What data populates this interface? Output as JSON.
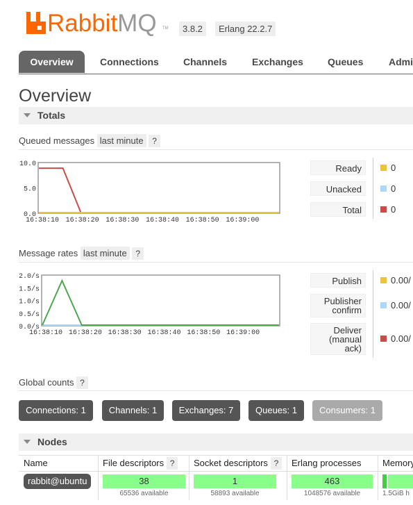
{
  "header": {
    "logo_rabbit": "Rabbit",
    "logo_mq": "MQ",
    "logo_tm": "TM",
    "version": "3.8.2",
    "erlang": "Erlang 22.2.7"
  },
  "tabs": [
    {
      "label": "Overview",
      "active": true
    },
    {
      "label": "Connections"
    },
    {
      "label": "Channels"
    },
    {
      "label": "Exchanges"
    },
    {
      "label": "Queues"
    },
    {
      "label": "Admi"
    }
  ],
  "page_title": "Overview",
  "totals": {
    "title": "Totals",
    "queued": {
      "label": "Queued messages",
      "range": "last minute",
      "help": "?",
      "legend": [
        {
          "label": "Ready",
          "value": "0",
          "color": "#edc240"
        },
        {
          "label": "Unacked",
          "value": "0",
          "color": "#afd8f8"
        },
        {
          "label": "Total",
          "value": "0",
          "color": "#cb4b4b"
        }
      ]
    },
    "rates": {
      "label": "Message rates",
      "range": "last minute",
      "help": "?",
      "legend": [
        {
          "label": "Publish",
          "value": "0.00/",
          "color": "#edc240"
        },
        {
          "label": "Publisher confirm",
          "value": "0.00/",
          "color": "#afd8f8"
        },
        {
          "label": "Deliver (manual ack)",
          "value": "0.00/",
          "color": "#cb4b4b"
        }
      ]
    }
  },
  "global_counts": {
    "label": "Global counts",
    "help": "?",
    "buttons": [
      {
        "label": "Connections: 1"
      },
      {
        "label": "Channels: 1"
      },
      {
        "label": "Exchanges: 7"
      },
      {
        "label": "Queues: 1"
      },
      {
        "label": "Consumers: 1"
      }
    ]
  },
  "nodes": {
    "title": "Nodes",
    "columns": [
      "Name",
      "File descriptors",
      "Socket descriptors",
      "Erlang processes",
      "Memory"
    ],
    "help": "?",
    "row": {
      "name": "rabbit@ubuntu",
      "fd": "38",
      "fd_avail": "65536 available",
      "sd": "1",
      "sd_avail": "58893 available",
      "ep": "463",
      "ep_avail": "1048576 available",
      "mem_avail": "1.5GiB h"
    }
  },
  "chart_data": [
    {
      "type": "line",
      "title": "Queued messages",
      "x": [
        "16:38:10",
        "16:38:20",
        "16:38:30",
        "16:38:40",
        "16:38:50",
        "16:39:00"
      ],
      "ylim": [
        0,
        10
      ],
      "yticks": [
        "10.0",
        "5.0",
        "0.0"
      ],
      "series": [
        {
          "name": "Ready",
          "color": "#edc240",
          "points": [
            [
              0,
              0
            ],
            [
              60,
              0
            ]
          ]
        },
        {
          "name": "Unacked",
          "color": "#afd8f8",
          "points": [
            [
              0,
              0
            ],
            [
              6,
              0
            ],
            [
              12,
              0
            ]
          ]
        },
        {
          "name": "Total",
          "color": "#cb4b4b",
          "points": [
            [
              0,
              9
            ],
            [
              6,
              9
            ],
            [
              10.5,
              0
            ],
            [
              60,
              0
            ]
          ]
        }
      ]
    },
    {
      "type": "line",
      "title": "Message rates",
      "x": [
        "16:38:10",
        "16:38:20",
        "16:38:30",
        "16:38:40",
        "16:38:50",
        "16:39:00"
      ],
      "ylim": [
        0,
        2
      ],
      "yticks": [
        "2.0/s",
        "1.5/s",
        "1.0/s",
        "0.5/s",
        "0.0/s"
      ],
      "series": [
        {
          "name": "Publish",
          "color": "#4da74d",
          "points": [
            [
              0,
              0
            ],
            [
              5,
              1.8
            ],
            [
              10,
              0
            ],
            [
              60,
              0
            ]
          ]
        },
        {
          "name": "Publisher confirm",
          "color": "#afd8f8",
          "points": [
            [
              0,
              0
            ],
            [
              60,
              0
            ]
          ]
        },
        {
          "name": "Deliver (manual ack)",
          "color": "#9440ed",
          "points": [
            [
              0,
              0
            ],
            [
              60,
              0
            ]
          ]
        }
      ]
    }
  ]
}
